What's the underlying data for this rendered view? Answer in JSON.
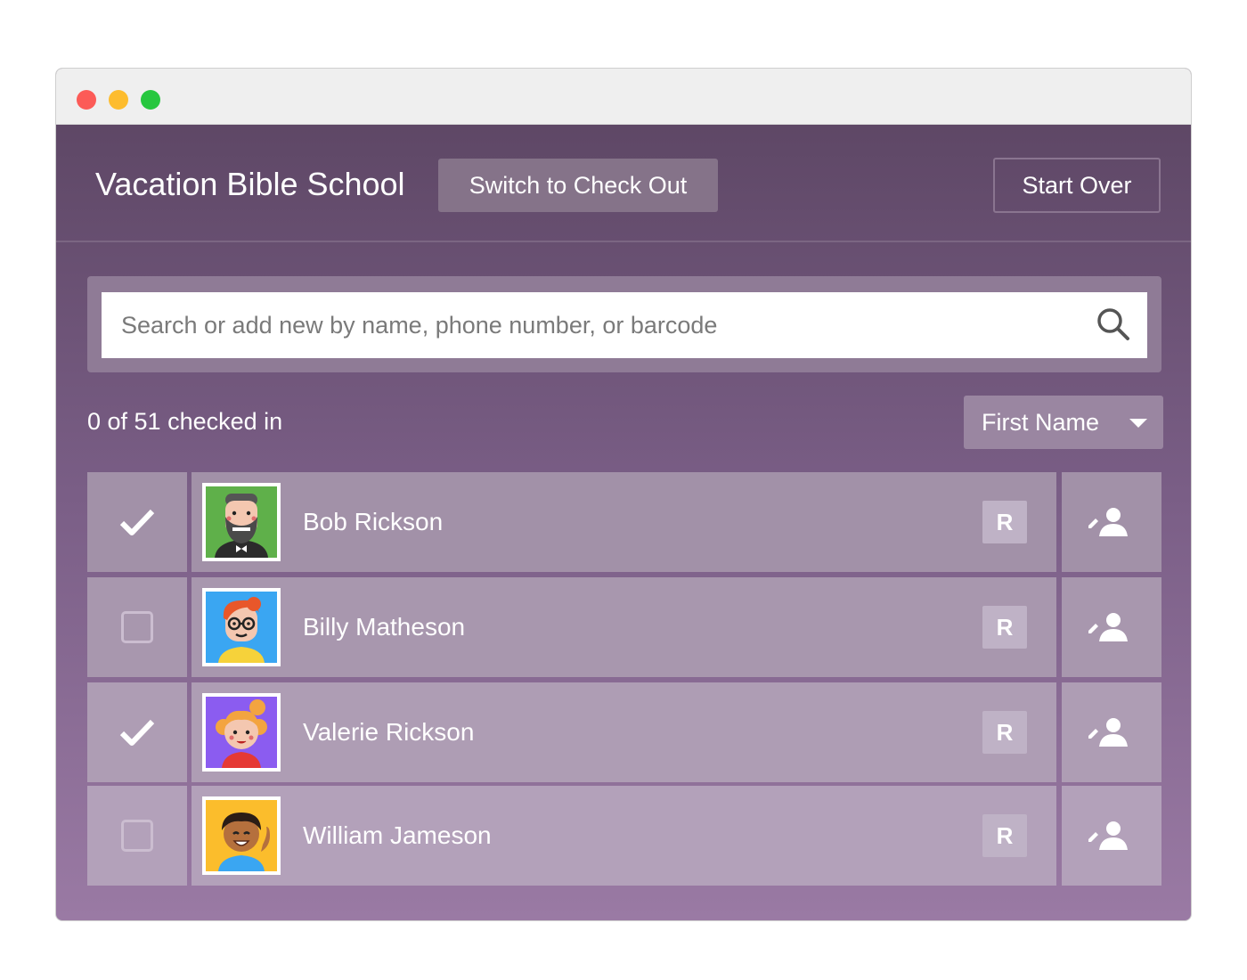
{
  "window": {
    "traffic_lights": [
      "close",
      "minimize",
      "maximize"
    ]
  },
  "header": {
    "title": "Vacation Bible School",
    "switch_label": "Switch to Check Out",
    "start_over_label": "Start Over"
  },
  "search": {
    "placeholder": "Search or add new by name, phone number, or barcode",
    "value": "",
    "icon": "search-icon"
  },
  "status": {
    "count_text": "0 of 51 checked in"
  },
  "sort": {
    "selected": "First Name"
  },
  "people": [
    {
      "name": "Bob Rickson",
      "checked": true,
      "badge": "R",
      "avatar_bg": "#5fb04a"
    },
    {
      "name": "Billy Matheson",
      "checked": false,
      "badge": "R",
      "avatar_bg": "#3aa6f2"
    },
    {
      "name": "Valerie Rickson",
      "checked": true,
      "badge": "R",
      "avatar_bg": "#8b5cf0"
    },
    {
      "name": "William Jameson",
      "checked": false,
      "badge": "R",
      "avatar_bg": "#fbbd2c"
    }
  ],
  "colors": {
    "background_top": "#5a4461",
    "background_bottom": "#9a7aa4",
    "row_bg": "#a291a8"
  }
}
